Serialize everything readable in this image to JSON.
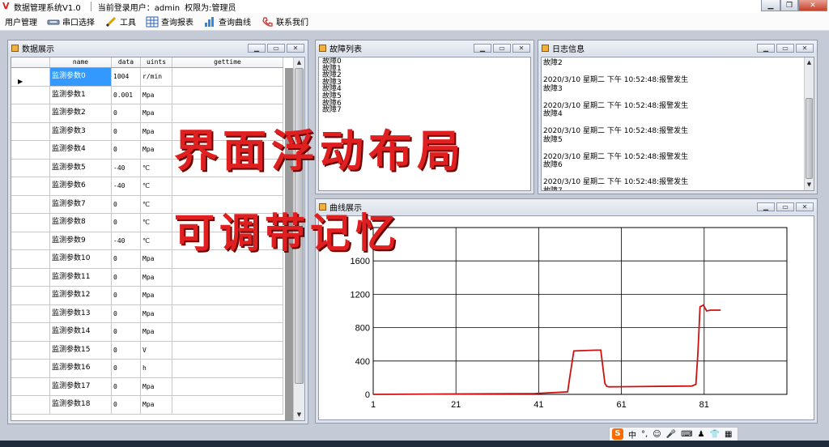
{
  "window": {
    "title": "数据管理系统V1.0",
    "user_text": "当前登录用户：admin",
    "perm_text": "权限为:管理员"
  },
  "menu": [
    {
      "label": "用户管理",
      "icon": "none"
    },
    {
      "label": "串口选择",
      "icon": "serial-port-icon"
    },
    {
      "label": "工具",
      "icon": "pencil-icon"
    },
    {
      "label": "查询报表",
      "icon": "table-icon"
    },
    {
      "label": "查询曲线",
      "icon": "bar-chart-icon"
    },
    {
      "label": "联系我们",
      "icon": "phone-icon"
    }
  ],
  "panels": {
    "data": {
      "title": "数据展示"
    },
    "fault": {
      "title": "故障列表"
    },
    "log": {
      "title": "日志信息"
    },
    "curve": {
      "title": "曲线展示"
    }
  },
  "grid": {
    "headers": [
      "name",
      "data",
      "uints",
      "gettime"
    ],
    "rows": [
      {
        "name": "监测参数0",
        "data": "1004",
        "unit": "r/min"
      },
      {
        "name": "监测参数1",
        "data": "0.001",
        "unit": "Mpa"
      },
      {
        "name": "监测参数2",
        "data": "0",
        "unit": "Mpa"
      },
      {
        "name": "监测参数3",
        "data": "0",
        "unit": "Mpa"
      },
      {
        "name": "监测参数4",
        "data": "0",
        "unit": "Mpa"
      },
      {
        "name": "监测参数5",
        "data": "-40",
        "unit": "℃"
      },
      {
        "name": "监测参数6",
        "data": "-40",
        "unit": "℃"
      },
      {
        "name": "监测参数7",
        "data": "0",
        "unit": "℃"
      },
      {
        "name": "监测参数8",
        "data": "0",
        "unit": "℃"
      },
      {
        "name": "监测参数9",
        "data": "-40",
        "unit": "℃"
      },
      {
        "name": "监测参数10",
        "data": "0",
        "unit": "Mpa"
      },
      {
        "name": "监测参数11",
        "data": "0",
        "unit": "Mpa"
      },
      {
        "name": "监测参数12",
        "data": "0",
        "unit": "Mpa"
      },
      {
        "name": "监测参数13",
        "data": "0",
        "unit": "Mpa"
      },
      {
        "name": "监测参数14",
        "data": "0",
        "unit": "Mpa"
      },
      {
        "name": "监测参数15",
        "data": "0",
        "unit": "V"
      },
      {
        "name": "监测参数16",
        "data": "0",
        "unit": "h"
      },
      {
        "name": "监测参数17",
        "data": "0",
        "unit": "Mpa"
      },
      {
        "name": "监测参数18",
        "data": "0",
        "unit": "Mpa"
      }
    ]
  },
  "fault_list": "故障0\n故障1\n故障2\n故障3\n故障4\n故障5\n故障6\n故障7",
  "log_text": "故障2\n\n2020/3/10 星期二 下午 10:52:48:报警发生\n故障3\n\n2020/3/10 星期二 下午 10:52:48:报警发生\n故障4\n\n2020/3/10 星期二 下午 10:52:48:报警发生\n故障5\n\n2020/3/10 星期二 下午 10:52:48:报警发生\n故障6\n\n2020/3/10 星期二 下午 10:52:48:报警发生\n故障7",
  "overlay": {
    "line1": "界面浮动布局",
    "line2": "可调带记忆"
  },
  "tray": {
    "ime": "中",
    "punct": "°,"
  },
  "chart_data": {
    "type": "line",
    "x_ticks": [
      1,
      21,
      41,
      61,
      81
    ],
    "y_ticks": [
      0,
      400,
      800,
      1200,
      1600
    ],
    "xlim": [
      1,
      101
    ],
    "ylim": [
      0,
      2000
    ],
    "grid": true,
    "series": [
      {
        "color": "#cc1111",
        "x": [
          1,
          40,
          48,
          48.5,
          49.5,
          55,
          56,
          57,
          57.5,
          58,
          78,
          79,
          79.5,
          80,
          80.8,
          81.6,
          82.5,
          85
        ],
        "y": [
          0,
          10,
          30,
          200,
          520,
          530,
          530,
          130,
          95,
          90,
          100,
          120,
          500,
          1050,
          1070,
          1000,
          1010,
          1010
        ]
      }
    ]
  }
}
